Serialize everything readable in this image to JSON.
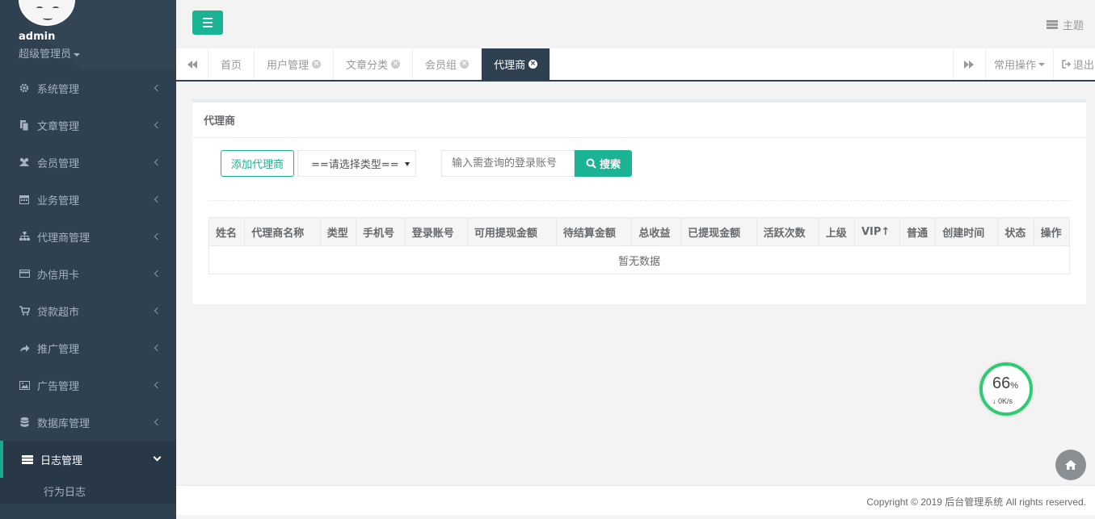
{
  "profile": {
    "name": "admin",
    "role": "超级管理员"
  },
  "sidebar": {
    "items": [
      {
        "label": "系统管理",
        "icon": "gear-icon"
      },
      {
        "label": "文章管理",
        "icon": "file-icon"
      },
      {
        "label": "会员管理",
        "icon": "users-icon"
      },
      {
        "label": "业务管理",
        "icon": "calendar-icon"
      },
      {
        "label": "代理商管理",
        "icon": "sitemap-icon"
      },
      {
        "label": "办信用卡",
        "icon": "credit-card-icon"
      },
      {
        "label": "贷款超市",
        "icon": "cart-icon"
      },
      {
        "label": "推广管理",
        "icon": "share-icon"
      },
      {
        "label": "广告管理",
        "icon": "image-icon"
      },
      {
        "label": "数据库管理",
        "icon": "database-icon"
      },
      {
        "label": "日志管理",
        "icon": "log-icon"
      }
    ],
    "sub_items": [
      "行为日志"
    ]
  },
  "topbar": {
    "theme_label": "主题"
  },
  "tabs": {
    "items": [
      {
        "label": "首页"
      },
      {
        "label": "用户管理"
      },
      {
        "label": "文章分类"
      },
      {
        "label": "会员组"
      },
      {
        "label": "代理商"
      }
    ],
    "ops_label": "常用操作",
    "logout_label": "退出"
  },
  "panel": {
    "title": "代理商",
    "add_button": "添加代理商",
    "type_select": "==请选择类型==",
    "search_placeholder": "输入需查询的登录账号",
    "search_button": "搜索"
  },
  "table": {
    "headers": [
      "姓名",
      "代理商名称",
      "类型",
      "手机号",
      "登录账号",
      "可用提现金额",
      "待结算金额",
      "总收益",
      "已提现金额",
      "活跃次数",
      "上级",
      "VIP↑",
      "普通",
      "创建时间",
      "状态",
      "操作"
    ],
    "empty_text": "暂无数据"
  },
  "footer": {
    "copyright": "Copyright © 2019 后台管理系统 All rights reserved."
  },
  "speed_widget": {
    "percent": "66",
    "percent_sign": "%",
    "rate": "0K/s"
  },
  "colors": {
    "sidebar": "#2f4050",
    "accent": "#1ab394",
    "active_tab": "#2f4050"
  }
}
